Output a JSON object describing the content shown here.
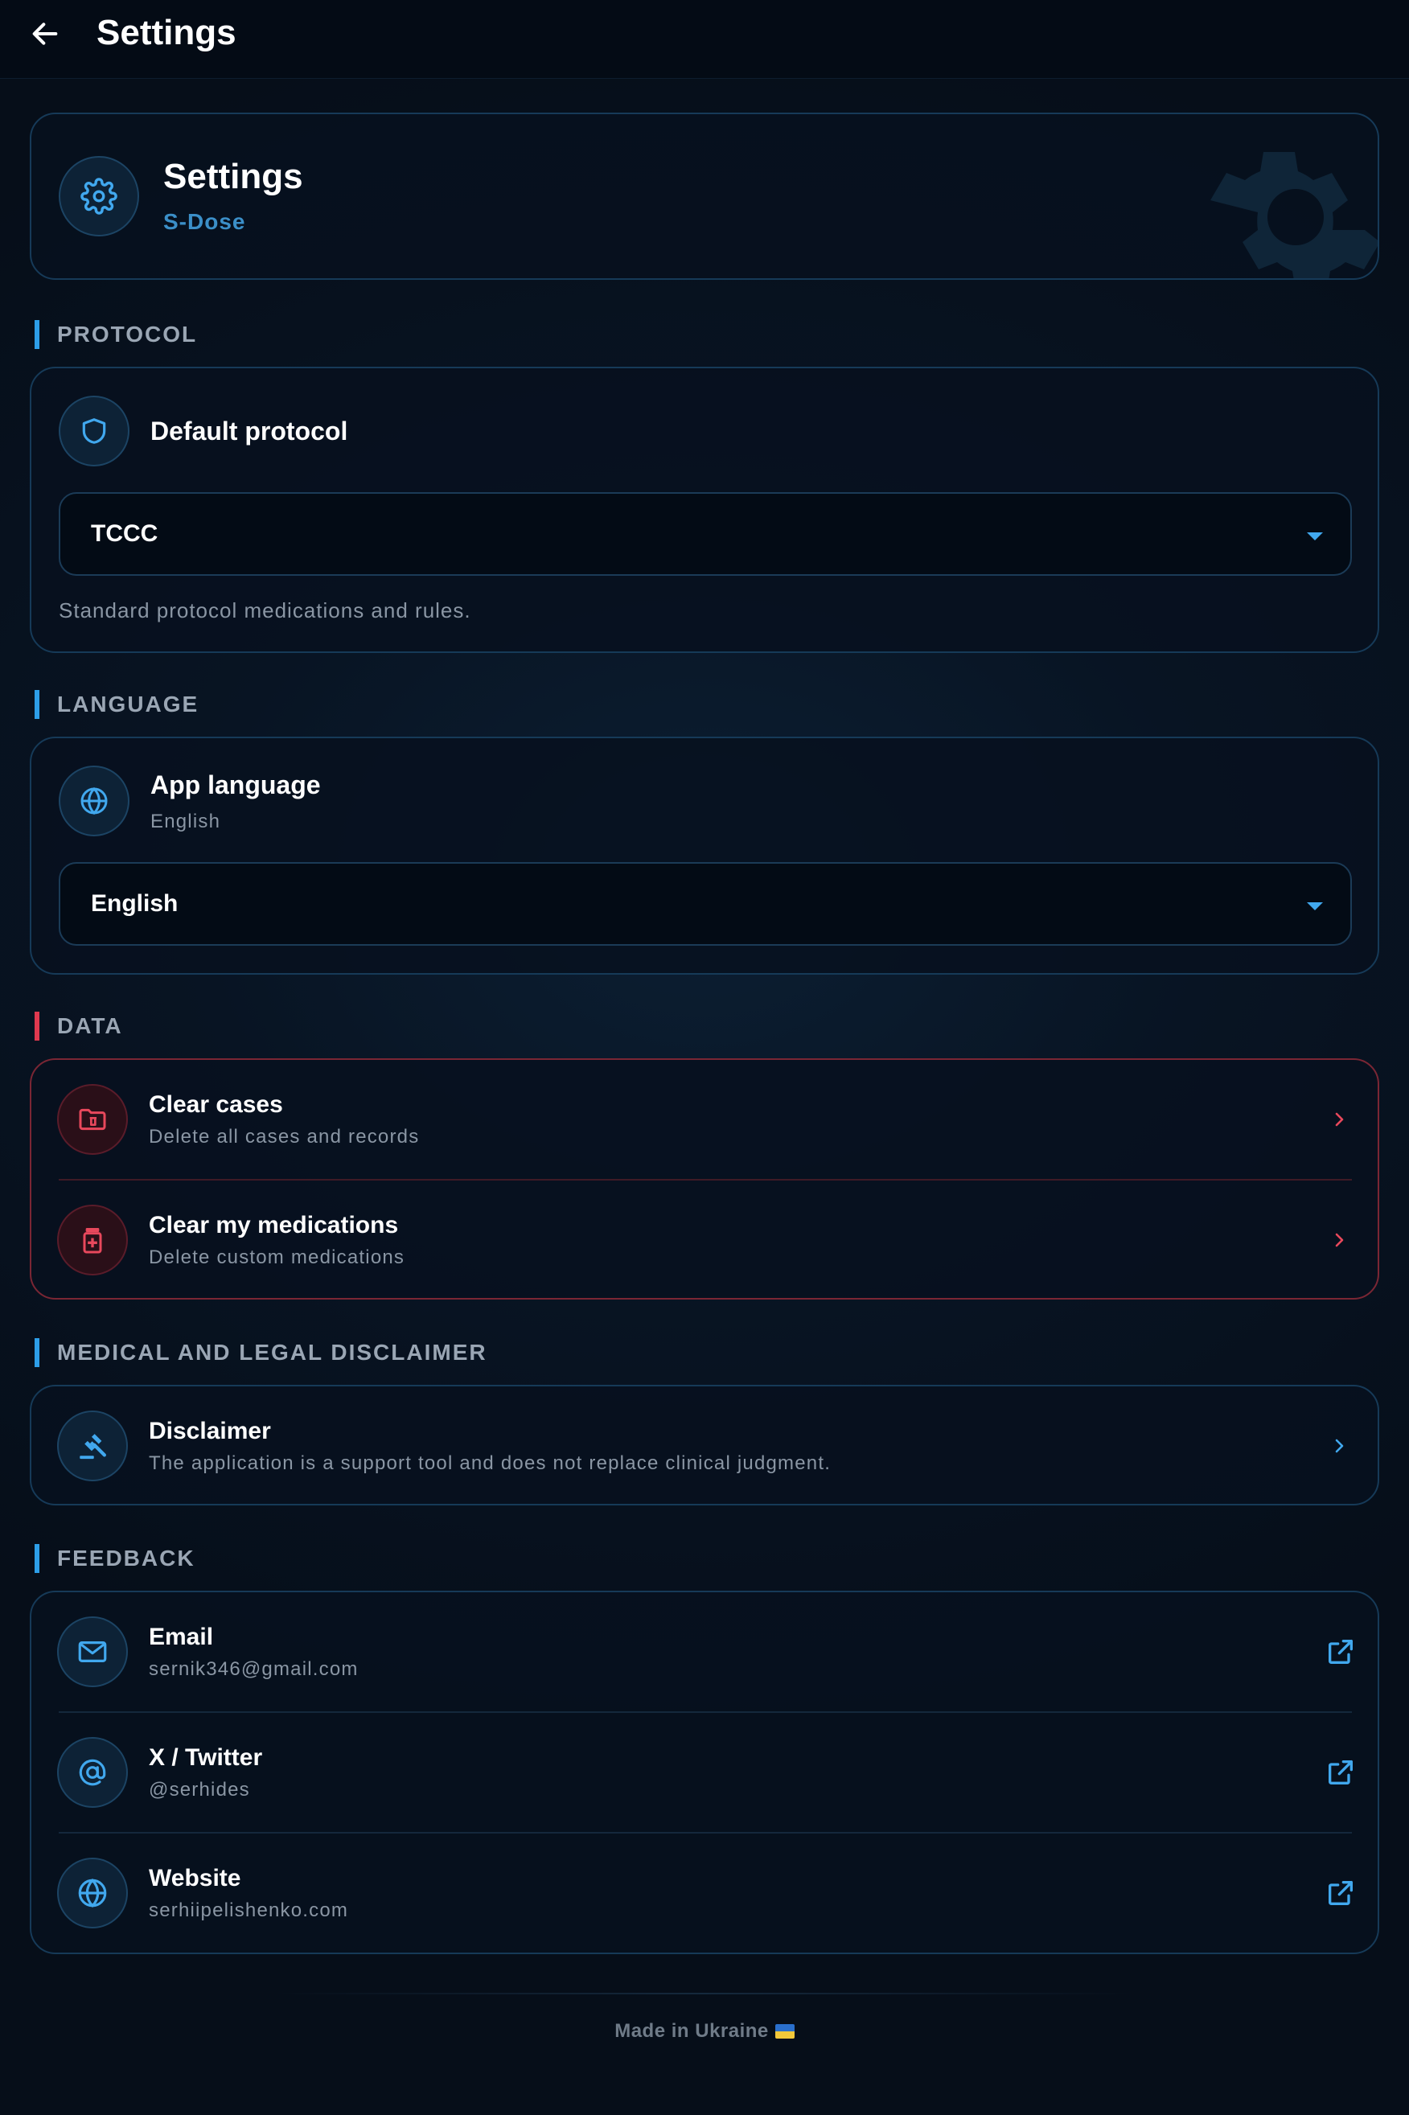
{
  "appbar": {
    "title": "Settings"
  },
  "hero": {
    "title": "Settings",
    "subtitle": "S-Dose"
  },
  "sections": {
    "protocol": {
      "label": "PROTOCOL",
      "title": "Default protocol",
      "selected": "TCCC",
      "description": "Standard protocol medications and rules."
    },
    "language": {
      "label": "LANGUAGE",
      "title": "App language",
      "current": "English",
      "selected": "English"
    },
    "data": {
      "label": "DATA",
      "items": [
        {
          "title": "Clear cases",
          "subtitle": "Delete all cases and records"
        },
        {
          "title": "Clear my medications",
          "subtitle": "Delete custom medications"
        }
      ]
    },
    "disclaimer": {
      "label": "MEDICAL AND LEGAL DISCLAIMER",
      "title": "Disclaimer",
      "subtitle": "The application is a support tool and does not replace clinical judgment."
    },
    "feedback": {
      "label": "FEEDBACK",
      "items": [
        {
          "title": "Email",
          "subtitle": "sernik346@gmail.com"
        },
        {
          "title": "X / Twitter",
          "subtitle": "@serhides"
        },
        {
          "title": "Website",
          "subtitle": "serhiipelishenko.com"
        }
      ]
    }
  },
  "footer": {
    "text": "Made in Ukraine"
  },
  "colors": {
    "accent": "#2d9ee8",
    "danger": "#e0394f",
    "background": "#081423",
    "card_border": "#163a58"
  }
}
